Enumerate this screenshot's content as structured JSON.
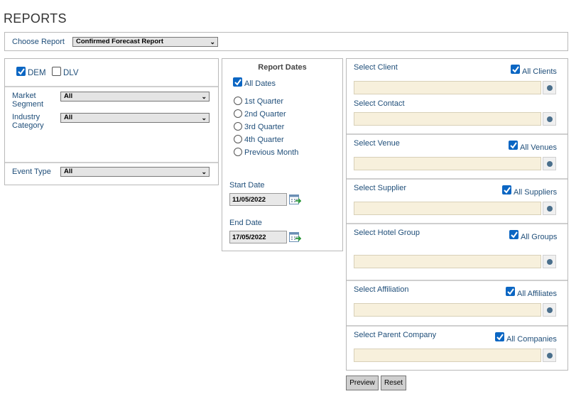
{
  "page_title": "REPORTS",
  "choose_report": {
    "label": "Choose Report",
    "value": "Confirmed Forecast Report"
  },
  "filters": {
    "dem_label": "DEM",
    "dem_checked": true,
    "dlv_label": "DLV",
    "dlv_checked": false,
    "market_segment_label_1": "Market",
    "market_segment_label_2": "Segment",
    "market_segment_value": "All",
    "industry_category_label_1": "Industry",
    "industry_category_label_2": "Category",
    "industry_category_value": "All",
    "event_type_label": "Event Type",
    "event_type_value": "All"
  },
  "report_dates": {
    "title": "Report Dates",
    "all_dates_label": "All Dates",
    "options": [
      "1st Quarter",
      "2nd Quarter",
      "3rd Quarter",
      "4th Quarter",
      "Previous Month"
    ],
    "start_label": "Start Date",
    "start_value": "11/05/2022",
    "end_label": "End Date",
    "end_value": "17/05/2022"
  },
  "selectors": {
    "client": {
      "label": "Select Client",
      "all_label": "All Clients"
    },
    "contact": {
      "label": "Select Contact"
    },
    "venue": {
      "label": "Select Venue",
      "all_label": "All Venues"
    },
    "supplier": {
      "label": "Select Supplier",
      "all_label": "All Suppliers"
    },
    "hotel_group": {
      "label": "Select Hotel Group",
      "all_label": "All Groups"
    },
    "affiliation": {
      "label": "Select Affiliation",
      "all_label": "All Affiliates"
    },
    "parent_company": {
      "label": "Select Parent Company",
      "all_label": "All Companies"
    }
  },
  "buttons": {
    "preview": "Preview",
    "reset": "Reset"
  },
  "colors": {
    "label_blue": "#1f4e79",
    "checkbox_blue": "#0b66c3",
    "field_cream": "#f7f0dc"
  }
}
